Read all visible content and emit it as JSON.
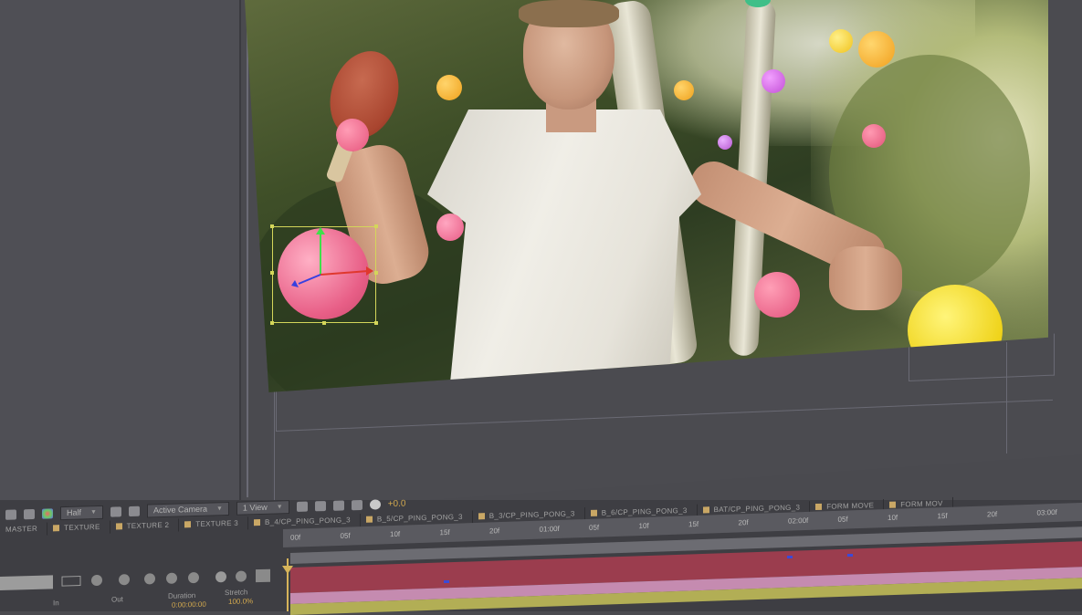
{
  "viewer": {
    "resolution": "Half",
    "camera": "Active Camera",
    "views": "1 View",
    "exposure": "+0.0"
  },
  "comp_tabs": [
    {
      "label": "B_4/CP_PING_PONG_3"
    },
    {
      "label": "B_5/CP_PING_PONG_3"
    },
    {
      "label": "B_3/CP_PING_PONG_3"
    },
    {
      "label": "B_6/CP_PING_PONG_3"
    },
    {
      "label": "BAT/CP_PING_PONG_3"
    },
    {
      "label": "FORM MOVE"
    },
    {
      "label": "FORM MOV"
    }
  ],
  "layer_tabs": [
    {
      "label": "MASTER"
    },
    {
      "label": "TEXTURE"
    },
    {
      "label": "TEXTURE 2"
    },
    {
      "label": "TEXTURE 3"
    }
  ],
  "ruler_ticks": [
    "00f",
    "05f",
    "10f",
    "15f",
    "20f",
    "01:00f",
    "05f",
    "10f",
    "15f",
    "20f",
    "02:00f",
    "05f",
    "10f",
    "15f",
    "20f",
    "03:00f"
  ],
  "columns": {
    "in": "In",
    "out": "Out",
    "duration": "Duration",
    "stretch": "Stretch"
  },
  "layer_values": {
    "in": "0:00:00:00",
    "stretch": "100.0%"
  },
  "colors": {
    "panel_bg": "#4a4a4f",
    "track_red": "#9b3d4e",
    "track_pink": "#c58bb0",
    "track_yellow": "#b2ae55",
    "playhead": "#d6b45a",
    "selection": "#d4d65a"
  }
}
